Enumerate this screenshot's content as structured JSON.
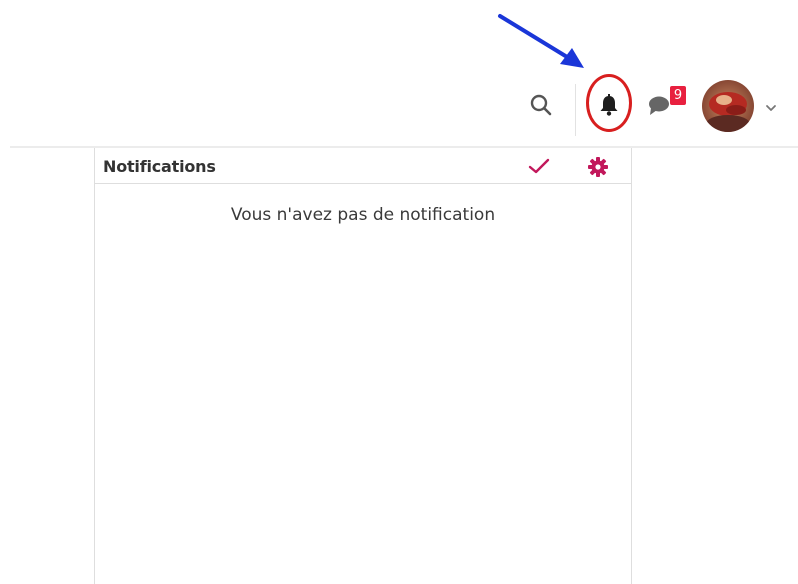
{
  "header": {
    "icons": {
      "search": "search-icon",
      "notifications": "bell-icon",
      "messages": "chat-bubble-icon",
      "account_menu": "chevron-down-icon"
    },
    "messages_badge": "9",
    "accent_color": "#c2185b",
    "badge_color": "#e8203f",
    "annotation_color": "#1a36d8",
    "highlight_color": "#d81f1f"
  },
  "notifications_panel": {
    "title": "Notifications",
    "mark_all_read_icon": "check-icon",
    "settings_icon": "gear-icon",
    "empty_message": "Vous n'avez pas de notification"
  }
}
